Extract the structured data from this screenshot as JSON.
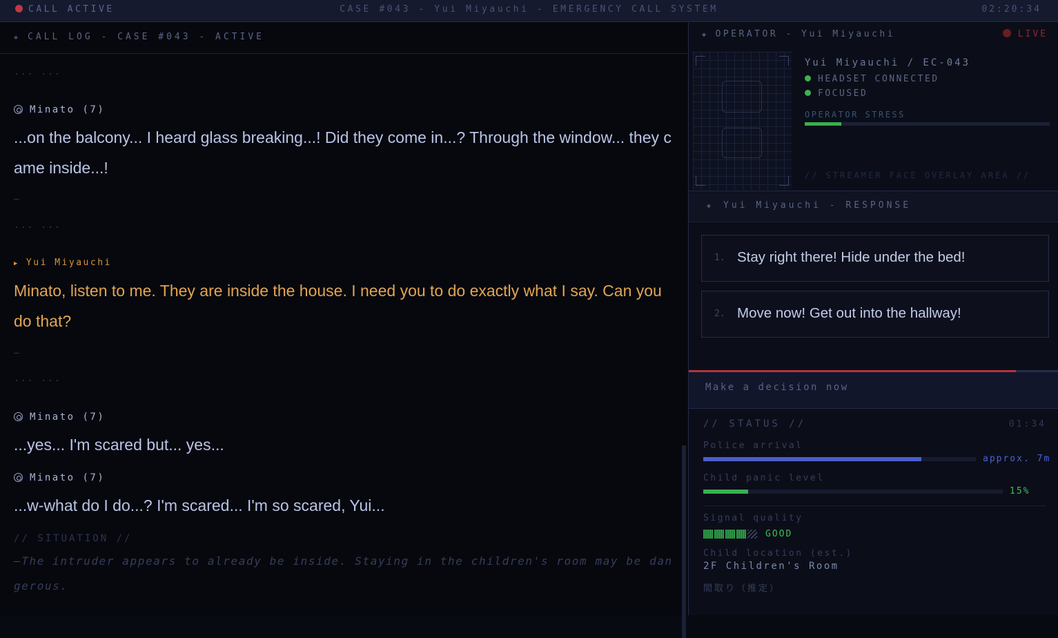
{
  "topbar": {
    "call_status": "CALL ACTIVE",
    "title": "CASE #043 - Yui Miyauchi - EMERGENCY CALL SYSTEM",
    "clock": "02:20:34"
  },
  "log": {
    "header": "CALL LOG - CASE #043 - ACTIVE",
    "ellipsis": "... ...",
    "dash": "–",
    "entries": [
      {
        "speaker": "Minato (7)",
        "text": "...on the balcony... I heard glass breaking...! Did they come in...? Through the window... they came inside...!"
      },
      {
        "speaker": "Yui Miyauchi",
        "text": "Minato, listen to me. They are inside the house. I need you to do exactly what I say. Can you do that?"
      },
      {
        "speaker": "Minato (7)",
        "text": "...yes... I'm scared but... yes..."
      },
      {
        "speaker": "Minato (7)",
        "text": "...w-what do I do...? I'm scared... I'm so scared, Yui..."
      }
    ],
    "situation_header": "// SITUATION //",
    "situation_text": "—The intruder appears to already be inside. Staying in the children's room may be dangerous."
  },
  "operator": {
    "header": "OPERATOR - Yui Miyauchi",
    "live": "LIVE",
    "name": "Yui Miyauchi / EC-043",
    "flags": [
      "HEADSET CONNECTED",
      "FOCUSED"
    ],
    "stress_label": "OPERATOR STRESS",
    "stress_level": 0.15,
    "overlay_note": "// STREAMER FACE OVERLAY AREA //"
  },
  "response": {
    "header": "Yui Miyauchi - RESPONSE",
    "choices": [
      {
        "num": "1.",
        "text": "Stay right there! Hide under the bed!"
      },
      {
        "num": "2.",
        "text": "Move now! Get out into the hallway!"
      }
    ],
    "timer_remaining": 0.885,
    "decision_prompt": "Make a decision now"
  },
  "status": {
    "header": "// STATUS //",
    "time": "01:34",
    "police_label": "Police arrival",
    "police_progress": 0.8,
    "police_value": "approx. 7m",
    "panic_label": "Child panic level",
    "panic_percent": 15,
    "panic_value": "15%",
    "signal_label": "Signal quality",
    "signal_bars": 4,
    "signal_total": 5,
    "signal_value": "GOOD",
    "location_label": "Child location (est.)",
    "location_value": "2F Children's Room",
    "location_jp": "間取り（推定）"
  },
  "colors": {
    "accent_red": "#c23744",
    "accent_orange": "#d9953a",
    "accent_green": "#3fb04f",
    "accent_blue": "#4a5fcc"
  }
}
